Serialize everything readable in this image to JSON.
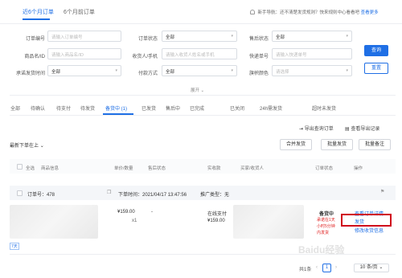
{
  "top_tabs": [
    "近6个月订单",
    "6个月前订单"
  ],
  "notice": {
    "text": "新手导航：还不清楚发货规则？快来规则中心看看吧",
    "link": "查看更多"
  },
  "filters": {
    "order_no": {
      "label": "订单编号",
      "placeholder": "请输入订单编号"
    },
    "order_status": {
      "label": "订单状态",
      "value": "全部"
    },
    "after_sale": {
      "label": "售后状态",
      "value": "全部"
    },
    "product": {
      "label": "商品名/ID",
      "placeholder": "请输入商品名/ID"
    },
    "receiver": {
      "label": "收货人/手机",
      "placeholder": "请输入收货人姓名或手机"
    },
    "tracking": {
      "label": "快递单号",
      "placeholder": "请输入快递单号"
    },
    "ship_time": {
      "label": "承诺发货时间",
      "value": "全部"
    },
    "pay_method": {
      "label": "付款方式",
      "value": "全部"
    },
    "flag_color": {
      "label": "旗帜颜色",
      "placeholder": "请选择"
    },
    "query_btn": "查询",
    "reset_btn": "重置",
    "expand": "展开"
  },
  "status_tabs": [
    "全部",
    "待确认",
    "待支付",
    "待发货",
    "备货中 (1)",
    "已发货",
    "售后中",
    "已完成",
    "已关闭",
    "24h需发货",
    "超时未发货"
  ],
  "tools": {
    "import": "导出查询订单",
    "view_export": "查看导出记录"
  },
  "sort": "最新下单在上",
  "actions": {
    "merge": "合并发货",
    "batch_ship": "批量发货",
    "batch_remark": "批量备注"
  },
  "table_headers": [
    "全选",
    "商品信息",
    "单价/数量",
    "售后状态",
    "实收款",
    "买家/收货人",
    "订单状态",
    "操作"
  ],
  "order": {
    "number_label": "订单号：478",
    "order_time": "下单时间：2021/04/17 13:47:56",
    "promo": "推广类型：无",
    "price": "¥159.00",
    "qty": "x1",
    "after_sale": "-",
    "pay_method": "在线支付",
    "paid": "¥159.00",
    "status": "备货中",
    "countdown": "承诺在1天小时5分钟内发货",
    "tag": "7天",
    "links": [
      "查看订单详情",
      "发货",
      "修改收货信息"
    ]
  },
  "pagination": {
    "total": "共1条",
    "current": "1",
    "page_size": "10 条/页"
  },
  "watermark": "Baidu经验"
}
